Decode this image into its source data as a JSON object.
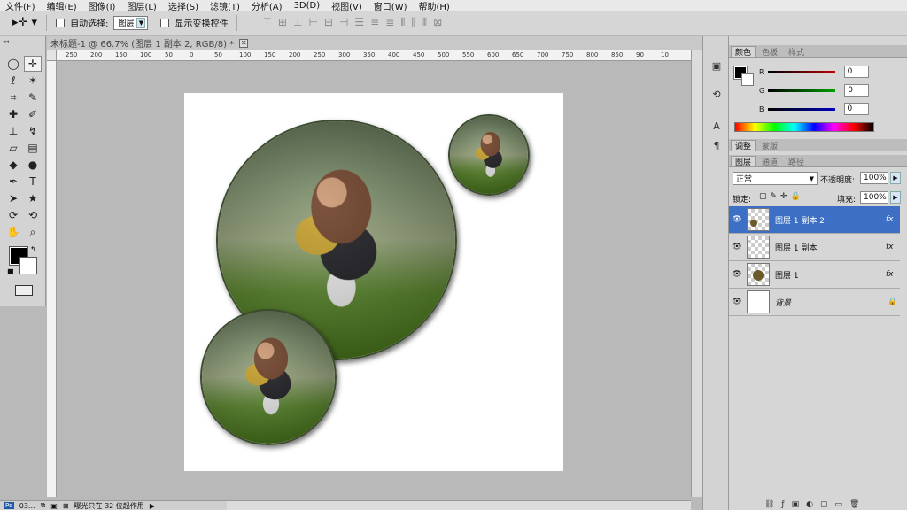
{
  "menubar": [
    "文件(F)",
    "编辑(E)",
    "图像(I)",
    "图层(L)",
    "选择(S)",
    "滤镜(T)",
    "分析(A)",
    "3D(D)",
    "视图(V)",
    "窗口(W)",
    "帮助(H)"
  ],
  "options": {
    "auto_select_label": "自动选择:",
    "auto_select_value": "图层",
    "show_transform_label": "显示变换控件"
  },
  "document": {
    "tab_title": "未标题-1 @ 66.7% (图层 1 副本 2, RGB/8) *",
    "ruler_ticks": [
      "250",
      "200",
      "150",
      "100",
      "50",
      "0",
      "50",
      "100",
      "150",
      "200",
      "250",
      "300",
      "350",
      "400",
      "450",
      "500",
      "550",
      "600",
      "650",
      "700",
      "750",
      "800",
      "850",
      "90",
      "10"
    ]
  },
  "color_panel": {
    "tabs": [
      "颜色",
      "色板",
      "样式"
    ],
    "r_label": "R",
    "g_label": "G",
    "b_label": "B",
    "r_value": "0",
    "g_value": "0",
    "b_value": "0",
    "colors": {
      "r": "#c00000",
      "g": "#00a000",
      "b": "#0000c0"
    }
  },
  "adjust_panel": {
    "tabs": [
      "调整",
      "蒙版"
    ]
  },
  "layers_panel": {
    "tabs": [
      "图层",
      "通道",
      "路径"
    ],
    "blend_mode": "正常",
    "opacity_label": "不透明度:",
    "opacity_value": "100%",
    "lock_label": "锁定:",
    "fill_label": "填充:",
    "fill_value": "100%",
    "layers": [
      {
        "name": "图层 1 副本 2",
        "fx": "fx",
        "selected": true
      },
      {
        "name": "图层 1 副本",
        "fx": "fx"
      },
      {
        "name": "图层 1",
        "fx": "fx"
      },
      {
        "name": "背景",
        "lock": "🔒"
      }
    ]
  },
  "statusbar": {
    "left": "03...",
    "message": "曝光只在 32 位起作用"
  }
}
